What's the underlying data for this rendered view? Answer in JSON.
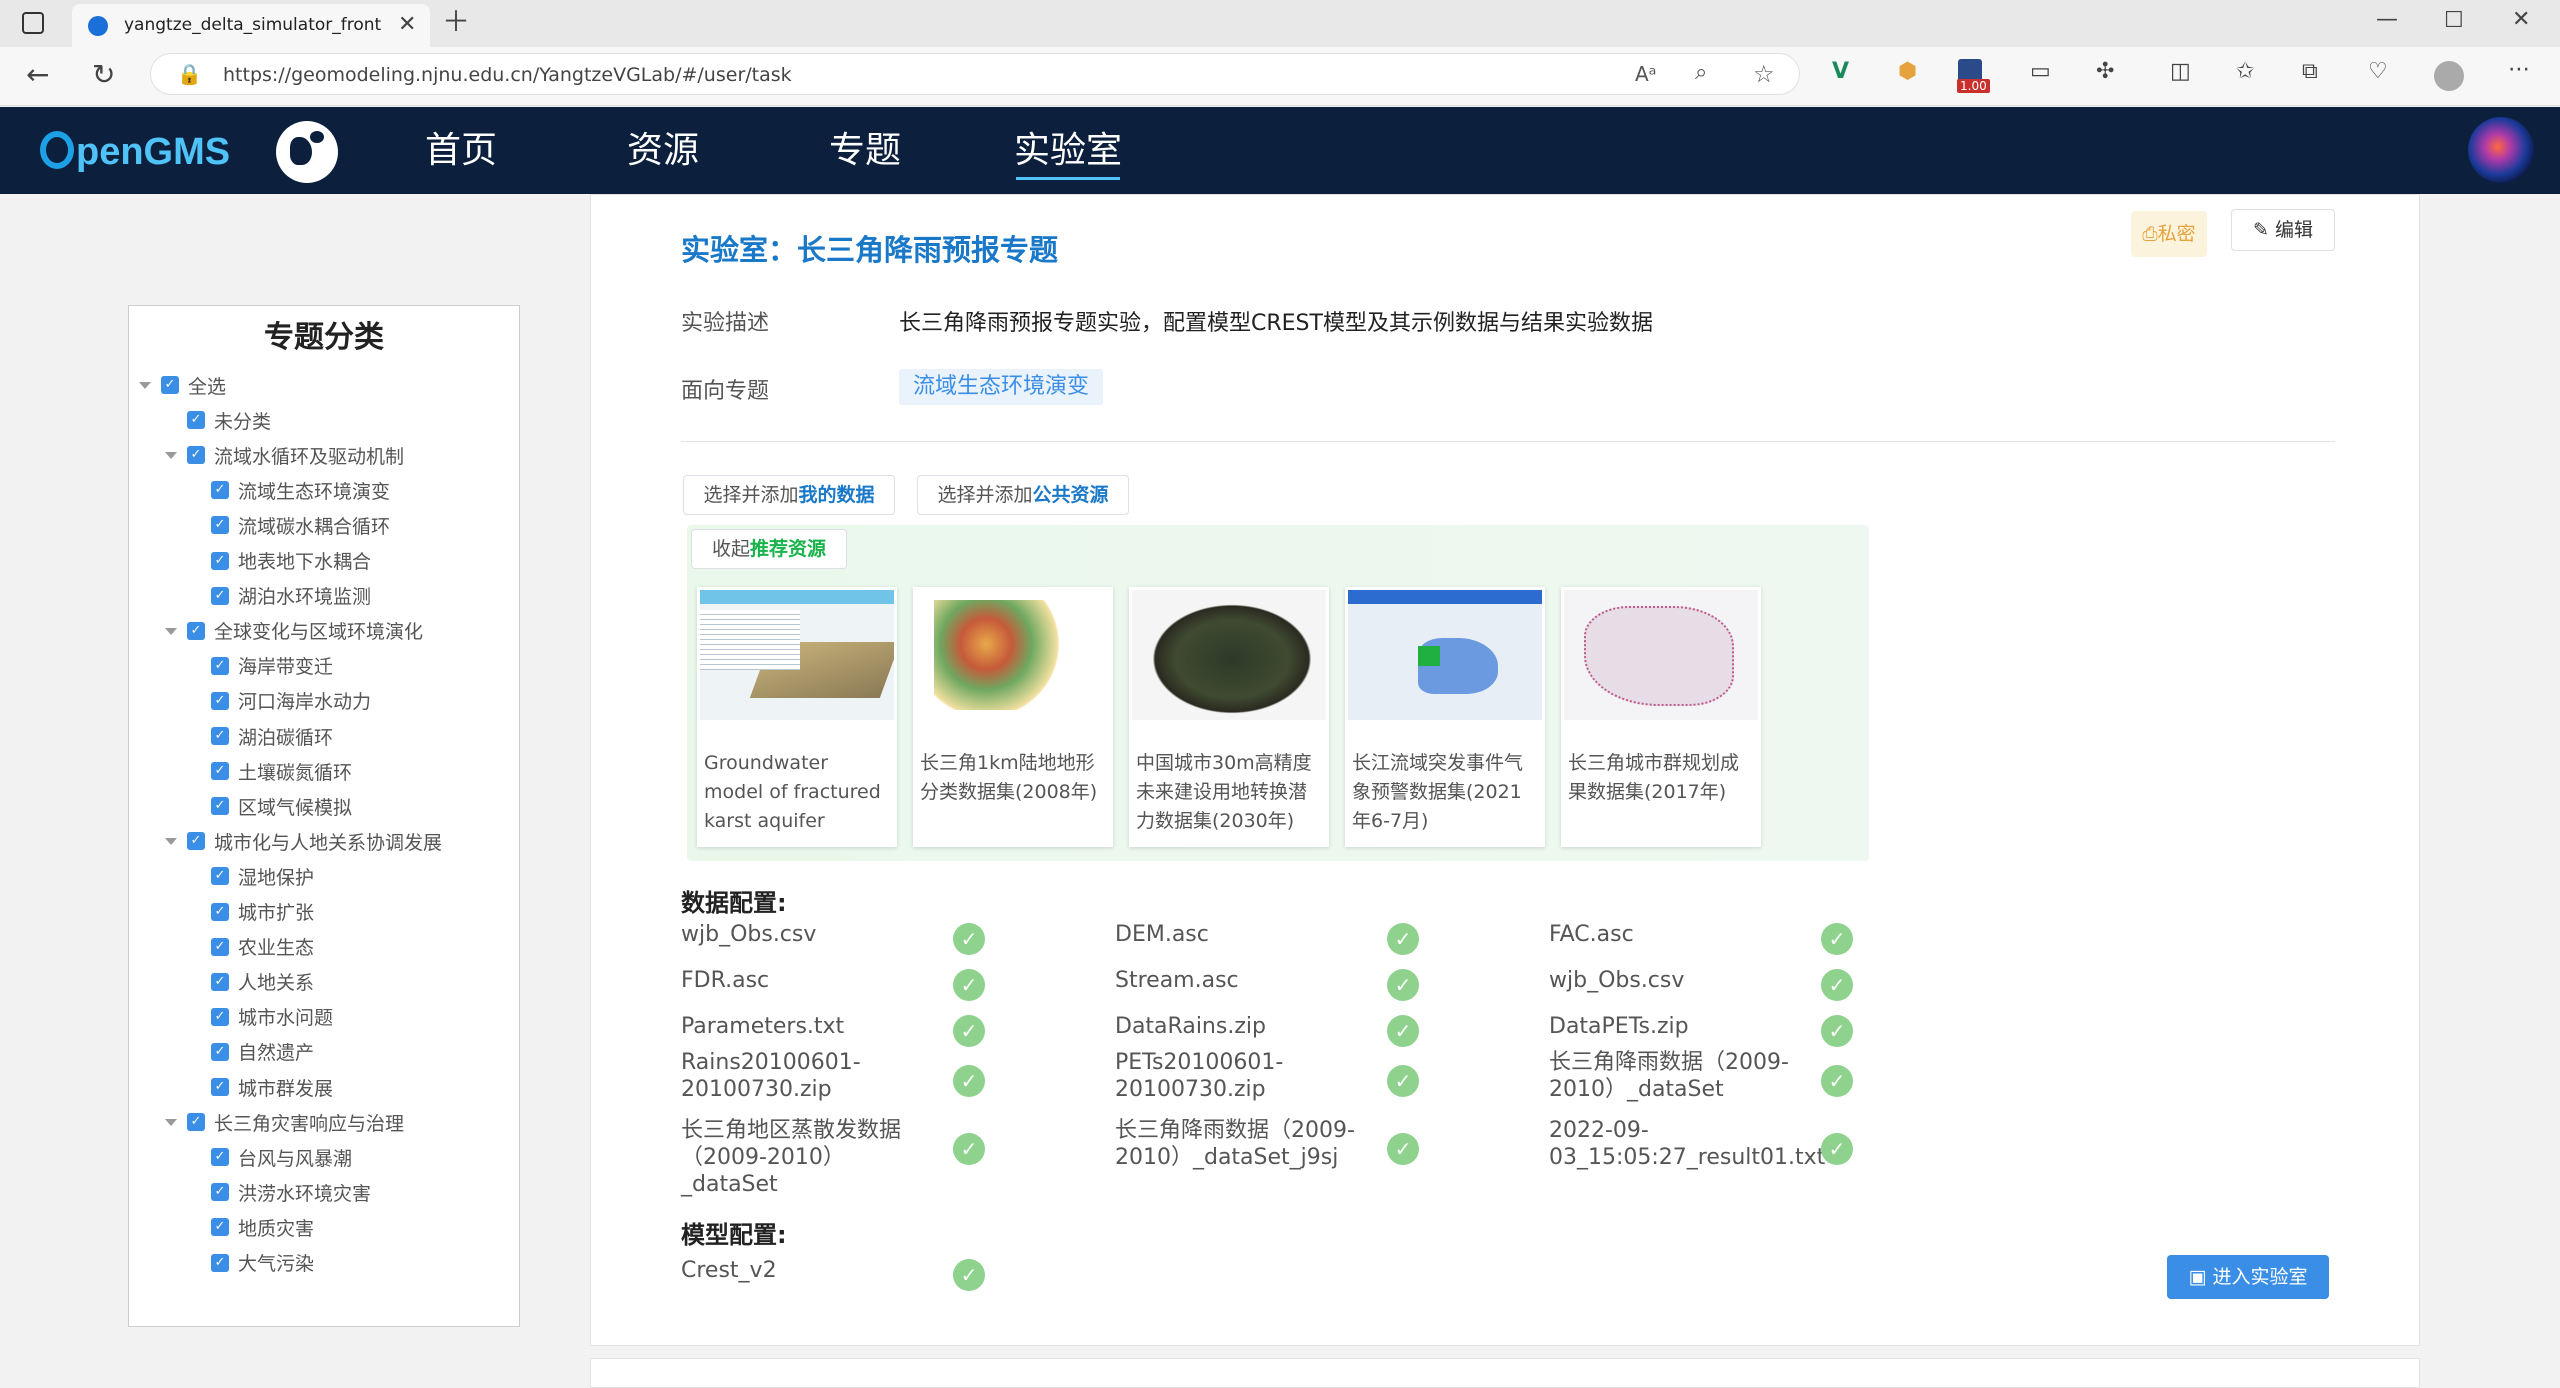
{
  "browser": {
    "tab_title": "yangtze_delta_simulator_front",
    "url": "https://geomodeling.njnu.edu.cn/YangtzeVGLab/#/user/task",
    "ext_badge": "1.00"
  },
  "nav": {
    "logo_text": "penGMS",
    "items": [
      "首页",
      "资源",
      "专题",
      "实验室"
    ],
    "active": "实验室"
  },
  "sidebar": {
    "title": "专题分类",
    "items": [
      {
        "label": "全选",
        "level": 0,
        "caret": true
      },
      {
        "label": "未分类",
        "level": 1,
        "caret": false
      },
      {
        "label": "流域水循环及驱动机制",
        "level": 1,
        "caret": true
      },
      {
        "label": "流域生态环境演变",
        "level": 2,
        "caret": false
      },
      {
        "label": "流域碳水耦合循环",
        "level": 2,
        "caret": false
      },
      {
        "label": "地表地下水耦合",
        "level": 2,
        "caret": false
      },
      {
        "label": "湖泊水环境监测",
        "level": 2,
        "caret": false
      },
      {
        "label": "全球变化与区域环境演化",
        "level": 1,
        "caret": true
      },
      {
        "label": "海岸带变迁",
        "level": 2,
        "caret": false
      },
      {
        "label": "河口海岸水动力",
        "level": 2,
        "caret": false
      },
      {
        "label": "湖泊碳循环",
        "level": 2,
        "caret": false
      },
      {
        "label": "土壤碳氮循环",
        "level": 2,
        "caret": false
      },
      {
        "label": "区域气候模拟",
        "level": 2,
        "caret": false
      },
      {
        "label": "城市化与人地关系协调发展",
        "level": 1,
        "caret": true
      },
      {
        "label": "湿地保护",
        "level": 2,
        "caret": false
      },
      {
        "label": "城市扩张",
        "level": 2,
        "caret": false
      },
      {
        "label": "农业生态",
        "level": 2,
        "caret": false
      },
      {
        "label": "人地关系",
        "level": 2,
        "caret": false
      },
      {
        "label": "城市水问题",
        "level": 2,
        "caret": false
      },
      {
        "label": "自然遗产",
        "level": 2,
        "caret": false
      },
      {
        "label": "城市群发展",
        "level": 2,
        "caret": false
      },
      {
        "label": "长三角灾害响应与治理",
        "level": 1,
        "caret": true
      },
      {
        "label": "台风与风暴潮",
        "level": 2,
        "caret": false
      },
      {
        "label": "洪涝水环境灾害",
        "level": 2,
        "caret": false
      },
      {
        "label": "地质灾害",
        "level": 2,
        "caret": false
      },
      {
        "label": "大气污染",
        "level": 2,
        "caret": false
      }
    ]
  },
  "lab": {
    "title": "实验室：长三角降雨预报专题",
    "private_label": "私密",
    "edit_label": "编辑",
    "desc_label": "实验描述",
    "desc_value": "长三角降雨预报专题实验，配置模型CREST模型及其示例数据与结果实验数据",
    "topic_label": "面向专题",
    "topic_value": "流域生态环境演变",
    "btn_my_data_prefix": "选择并添加",
    "btn_my_data_strong": "我的数据",
    "btn_public_prefix": "选择并添加",
    "btn_public_strong": "公共资源",
    "collapse_prefix": "收起",
    "collapse_strong": "推荐资源",
    "recommended": [
      "Groundwater model of fractured karst aquifer",
      "长三角1km陆地地形分类数据集(2008年)",
      "中国城市30m高精度未来建设用地转换潜力数据集(2030年)",
      "长江流域突发事件气象预警数据集(2021年6-7月)",
      "长三角城市群规划成果数据集(2017年)"
    ],
    "data_config_title": "数据配置:",
    "data_files": [
      "wjb_Obs.csv",
      "DEM.asc",
      "FAC.asc",
      "FDR.asc",
      "Stream.asc",
      "wjb_Obs.csv",
      "Parameters.txt",
      "DataRains.zip",
      "DataPETs.zip",
      "Rains20100601-20100730.zip",
      "PETs20100601-20100730.zip",
      "长三角降雨数据（2009-2010）_dataSet",
      "长三角地区蒸散发数据（2009-2010）_dataSet",
      "长三角降雨数据（2009-2010）_dataSet_j9sj",
      "2022-09-03_15:05:27_result01.txt"
    ],
    "model_config_title": "模型配置:",
    "model": "Crest_v2",
    "enter_label": "进入实验室"
  },
  "colors": {
    "nav_bg": "#0c1f3c",
    "accent": "#1a78c8",
    "ok": "#8ed28e",
    "green_text": "#18b34a"
  }
}
